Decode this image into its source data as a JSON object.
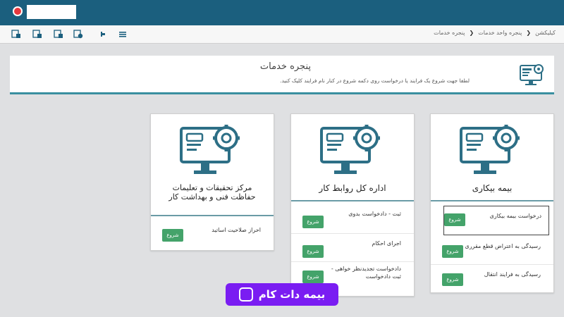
{
  "toolbar": {
    "breadcrumb": [
      "کیلیکشن",
      "پنجره واحد خدمات",
      "پنجره خدمات"
    ],
    "icons": [
      "doc-export-icon",
      "doc-list-icon",
      "doc-print-icon",
      "doc-money-icon",
      "pin-icon",
      "list-icon"
    ]
  },
  "header": {
    "title": "پنجره خدمات",
    "subtitle": "لطفا جهت شروع یک فرایند یا درخواست روی دکمه شروع در کنار نام فرایند کلیک کنید."
  },
  "cards": [
    {
      "title": "بیمه بیکاری",
      "items": [
        {
          "label": "درخواست بیمه بیکاری",
          "button": "شروع"
        },
        {
          "label": "رسیدگی به اعتراض قطع مقرری",
          "button": "شروع"
        },
        {
          "label": "رسیدگی به فرایند انتقال",
          "button": "شروع"
        }
      ]
    },
    {
      "title": "اداره کل روابط کار",
      "items": [
        {
          "label": "ثبت - دادخواست بدوی",
          "button": "شروع"
        },
        {
          "label": "اجرای احکام",
          "button": "شروع"
        },
        {
          "label": "دادخواست تجدیدنظر خواهی - ثبت دادخواست",
          "button": "شروع"
        }
      ]
    },
    {
      "title": "مرکز تحقیقات و تعلیمات حفاظت فنی و بهداشت کار",
      "items": [
        {
          "label": "احراز صلاحیت اساتید",
          "button": "شروع"
        }
      ]
    }
  ],
  "badge": {
    "text": "بیمه دات کام"
  },
  "colors": {
    "topbar": "#1b5f7e",
    "accent": "#3a8fa0",
    "start": "#44a36a",
    "badge": "#7a1df2"
  }
}
